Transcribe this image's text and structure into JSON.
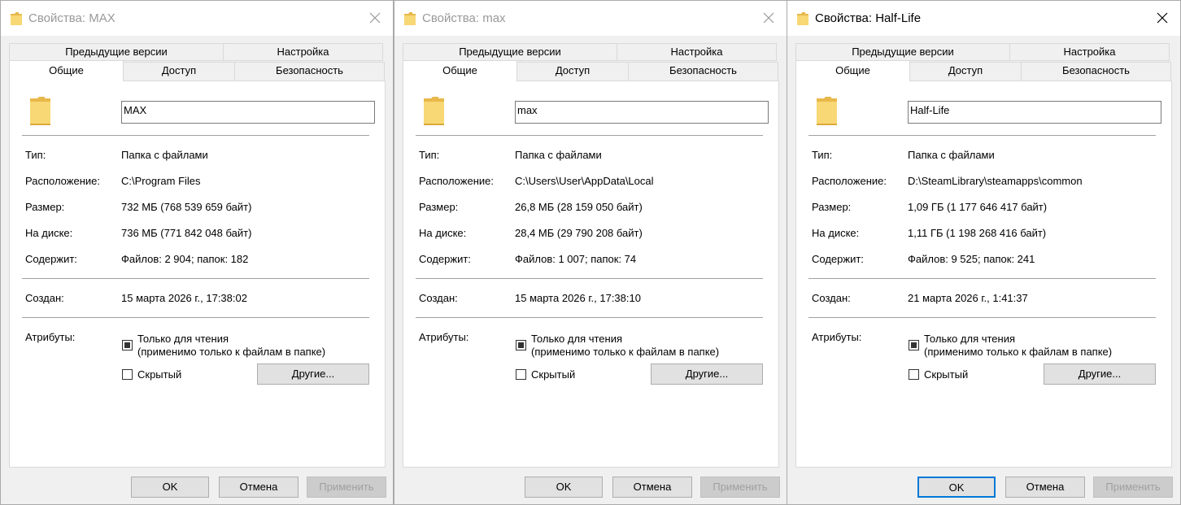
{
  "dialogs": [
    {
      "title": "Свойства: MAX",
      "active": false,
      "tabs": {
        "prev_versions": "Предыдущие версии",
        "customize": "Настройка",
        "general": "Общие",
        "sharing": "Доступ",
        "security": "Безопасность"
      },
      "name": "MAX",
      "labels": {
        "type": "Тип:",
        "location": "Расположение:",
        "size": "Размер:",
        "size_on_disk": "На диске:",
        "contains": "Содержит:",
        "created": "Создан:",
        "attributes": "Атрибуты:"
      },
      "values": {
        "type": "Папка с файлами",
        "location": "C:\\Program Files",
        "size": "732 МБ (768 539 659 байт)",
        "size_on_disk": "736 МБ (771 842 048 байт)",
        "contains": "Файлов: 2 904; папок: 182",
        "created": "15 марта 2026 г., 17:38:02"
      },
      "attributes": {
        "readonly_line1": "Только для чтения",
        "readonly_line2": "(применимо только к файлам в папке)",
        "hidden": "Скрытый",
        "other_button": "Другие..."
      },
      "buttons": {
        "ok": "OK",
        "cancel": "Отмена",
        "apply": "Применить"
      }
    },
    {
      "title": "Свойства: max",
      "active": false,
      "tabs": {
        "prev_versions": "Предыдущие версии",
        "customize": "Настройка",
        "general": "Общие",
        "sharing": "Доступ",
        "security": "Безопасность"
      },
      "name": "max",
      "labels": {
        "type": "Тип:",
        "location": "Расположение:",
        "size": "Размер:",
        "size_on_disk": "На диске:",
        "contains": "Содержит:",
        "created": "Создан:",
        "attributes": "Атрибуты:"
      },
      "values": {
        "type": "Папка с файлами",
        "location": "C:\\Users\\User\\AppData\\Local",
        "size": "26,8 МБ (28 159 050 байт)",
        "size_on_disk": "28,4 МБ (29 790 208 байт)",
        "contains": "Файлов: 1 007; папок: 74",
        "created": "15 марта 2026 г., 17:38:10"
      },
      "attributes": {
        "readonly_line1": "Только для чтения",
        "readonly_line2": "(применимо только к файлам в папке)",
        "hidden": "Скрытый",
        "other_button": "Другие..."
      },
      "buttons": {
        "ok": "OK",
        "cancel": "Отмена",
        "apply": "Применить"
      }
    },
    {
      "title": "Свойства: Half-Life",
      "active": true,
      "tabs": {
        "prev_versions": "Предыдущие версии",
        "customize": "Настройка",
        "general": "Общие",
        "sharing": "Доступ",
        "security": "Безопасность"
      },
      "name": "Half-Life",
      "labels": {
        "type": "Тип:",
        "location": "Расположение:",
        "size": "Размер:",
        "size_on_disk": "На диске:",
        "contains": "Содержит:",
        "created": "Создан:",
        "attributes": "Атрибуты:"
      },
      "values": {
        "type": "Папка с файлами",
        "location": "D:\\SteamLibrary\\steamapps\\common",
        "size": "1,09 ГБ (1 177 646 417 байт)",
        "size_on_disk": "1,11 ГБ (1 198 268 416 байт)",
        "contains": "Файлов: 9 525; папок: 241",
        "created": "21 марта 2026 г., 1:41:37"
      },
      "attributes": {
        "readonly_line1": "Только для чтения",
        "readonly_line2": "(применимо только к файлам в папке)",
        "hidden": "Скрытый",
        "other_button": "Другие..."
      },
      "buttons": {
        "ok": "OK",
        "cancel": "Отмена",
        "apply": "Применить"
      }
    }
  ],
  "colors": {
    "folder_body": "#f8d775",
    "folder_back": "#e8b84a",
    "accent_focus": "#0078d7",
    "disabled_text": "#a0a0a0"
  },
  "icons": {
    "title_icon": "folder-icon",
    "close": "close-icon",
    "large_icon": "folder-icon"
  }
}
